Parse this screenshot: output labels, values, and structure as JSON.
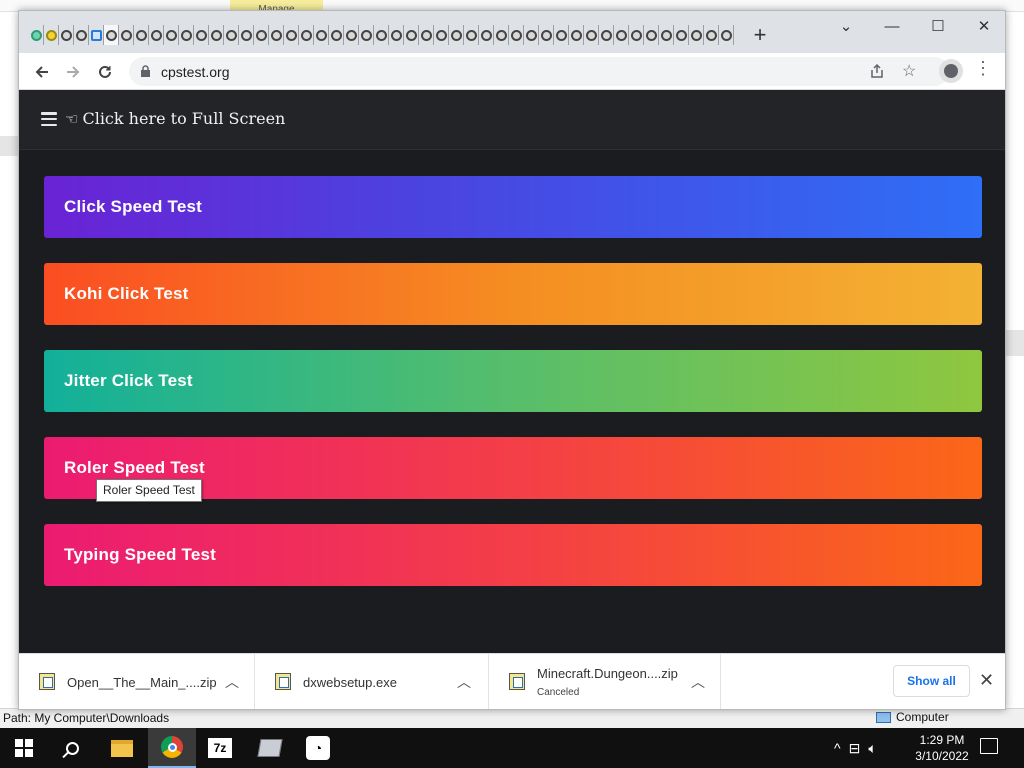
{
  "background_window": {
    "tab_label": "Manage",
    "path_label": "Path: My Computer\\Downloads",
    "computer_label": "Computer"
  },
  "browser": {
    "url": "cpstest.org",
    "new_tab_label": "+",
    "window_controls": {
      "dropdown": "⌄",
      "minimize": "—",
      "maximize": "☐",
      "close": "✕"
    }
  },
  "page": {
    "fullscreen_label": "Click here to Full Screen",
    "buttons": [
      {
        "label": "Click Speed Test"
      },
      {
        "label": "Kohi Click Test"
      },
      {
        "label": "Jitter Click Test"
      },
      {
        "label": "Roler Speed Test"
      },
      {
        "label": "Typing Speed Test"
      }
    ],
    "tooltip": "Roler Speed Test"
  },
  "downloads": {
    "items": [
      {
        "name": "Open__The__Main_....zip",
        "status": ""
      },
      {
        "name": "dxwebsetup.exe",
        "status": ""
      },
      {
        "name": "Minecraft.Dungeon....zip",
        "status": "Canceled"
      }
    ],
    "show_all_label": "Show all"
  },
  "taskbar": {
    "time": "1:29 PM",
    "date": "3/10/2022",
    "sevenz_label": "7z"
  },
  "colors": {
    "page_bg": "#1b1c20",
    "click_speed": [
      "#6a23d5",
      "#2f6ef6"
    ],
    "kohi": [
      "#fb4d22",
      "#f3b233"
    ],
    "jitter": [
      "#12b09a",
      "#8fc73f"
    ],
    "roler": [
      "#ec1b72",
      "#fb6717"
    ],
    "typing": [
      "#ec1b72",
      "#fb6717"
    ]
  }
}
